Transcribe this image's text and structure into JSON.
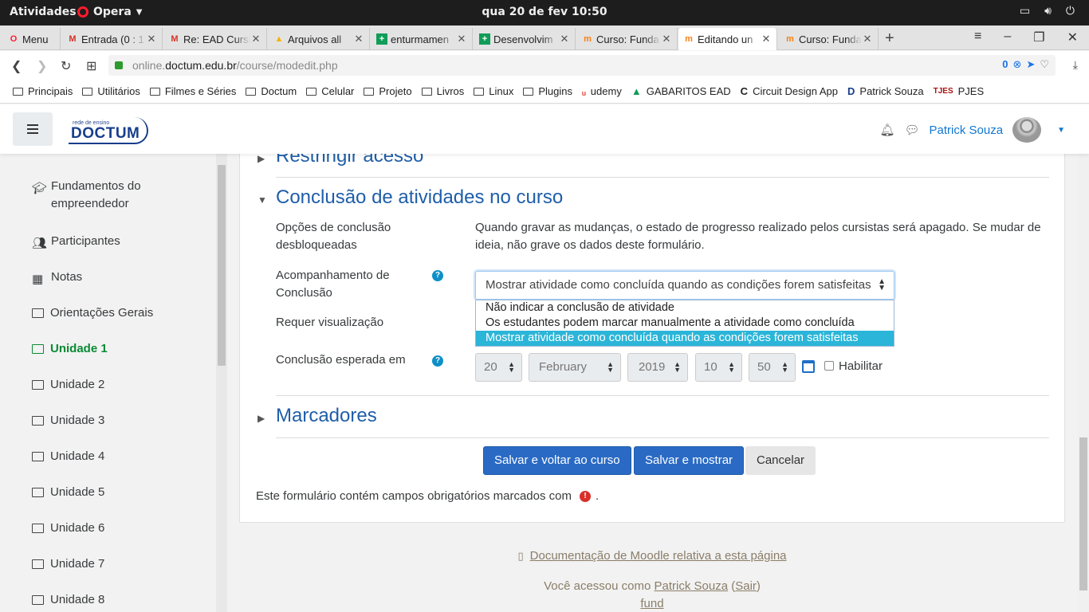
{
  "system": {
    "activities": "Atividades",
    "app_name": "Opera",
    "clock": "qua 20 de fev  10:50"
  },
  "tabs": [
    {
      "label": "Menu",
      "icon": "opera-icon"
    },
    {
      "label": "Entrada (0 : 1",
      "icon": "gmail-icon"
    },
    {
      "label": "Re: EAD Cursi",
      "icon": "gmail-icon"
    },
    {
      "label": "Arquivos all",
      "icon": "drive-icon"
    },
    {
      "label": "enturmamen",
      "icon": "sheets-icon"
    },
    {
      "label": "Desenvolvim",
      "icon": "sheets-icon"
    },
    {
      "label": "Curso: Funda",
      "icon": "moodle-icon"
    },
    {
      "label": "Editando un",
      "icon": "moodle-icon"
    },
    {
      "label": "Curso: Funda",
      "icon": "moodle-icon"
    }
  ],
  "address": {
    "host_prefix": "online.",
    "host": "doctum.edu.br",
    "path": "/course/modedit.php",
    "badge": "0"
  },
  "bookmarks": [
    {
      "label": "Principais",
      "type": "folder"
    },
    {
      "label": "Utilitários",
      "type": "folder"
    },
    {
      "label": "Filmes e Séries",
      "type": "folder"
    },
    {
      "label": "Doctum",
      "type": "folder"
    },
    {
      "label": "Celular",
      "type": "folder"
    },
    {
      "label": "Projeto",
      "type": "folder"
    },
    {
      "label": "Livros",
      "type": "folder"
    },
    {
      "label": "Linux",
      "type": "folder"
    },
    {
      "label": "Plugins",
      "type": "folder"
    },
    {
      "label": "udemy",
      "type": "udemy-icon"
    },
    {
      "label": "GABARITOS EAD",
      "type": "drive-icon"
    },
    {
      "label": "Circuit Design App",
      "type": "circuit-icon"
    },
    {
      "label": "Patrick Souza",
      "type": "d-icon"
    },
    {
      "label": "PJES",
      "type": "pjes-icon"
    }
  ],
  "header": {
    "logo_small": "rede de ensino",
    "logo_big": "DOCTUM",
    "user_name": "Patrick Souza"
  },
  "sidebar": {
    "items": [
      {
        "label": "Fundamentos do empreendedor",
        "icon": "graduation-cap-icon",
        "active": false
      },
      {
        "label": "Participantes",
        "icon": "users-icon",
        "active": false
      },
      {
        "label": "Notas",
        "icon": "table-icon",
        "active": false
      },
      {
        "label": "Orientações Gerais",
        "icon": "folder-icon",
        "active": false
      },
      {
        "label": "Unidade 1",
        "icon": "folder-icon",
        "active": true
      },
      {
        "label": "Unidade 2",
        "icon": "folder-icon",
        "active": false
      },
      {
        "label": "Unidade 3",
        "icon": "folder-icon",
        "active": false
      },
      {
        "label": "Unidade 4",
        "icon": "folder-icon",
        "active": false
      },
      {
        "label": "Unidade 5",
        "icon": "folder-icon",
        "active": false
      },
      {
        "label": "Unidade 6",
        "icon": "folder-icon",
        "active": false
      },
      {
        "label": "Unidade 7",
        "icon": "folder-icon",
        "active": false
      },
      {
        "label": "Unidade 8",
        "icon": "folder-icon",
        "active": false
      }
    ]
  },
  "form": {
    "restrict_title": "Restringir acesso",
    "completion_title": "Conclusão de atividades no curso",
    "unlocked_label": "Opções de conclusão desbloqueadas",
    "unlocked_text": "Quando gravar as mudanças, o estado de progresso realizado pelos cursistas será apagado. Se mudar de ideia, não grave os dados deste formulário.",
    "tracking_label": "Acompanhamento de Conclusão",
    "tracking_value": "Mostrar atividade como concluída quando as condições forem satisfeitas",
    "tracking_options": [
      "Não indicar a conclusão de atividade",
      "Os estudantes podem marcar manualmente a atividade como concluída",
      "Mostrar atividade como concluída quando as condições forem satisfeitas"
    ],
    "view_label": "Requer visualização",
    "expected_label": "Conclusão esperada em",
    "date": {
      "day": "20",
      "month": "February",
      "year": "2019",
      "hour": "10",
      "minute": "50"
    },
    "enable_label": "Habilitar",
    "tags_title": "Marcadores",
    "save_return": "Salvar e voltar ao curso",
    "save_show": "Salvar e mostrar",
    "cancel": "Cancelar",
    "required_note": "Este formulário contém campos obrigatórios marcados com",
    "required_end": "."
  },
  "footer": {
    "doc_link": "Documentação de Moodle relativa a esta página",
    "logged_prefix": "Você acessou como",
    "user_link": "Patrick Souza",
    "logout": "Sair",
    "fund": "fund"
  },
  "colors": {
    "accent": "#1f5ea8",
    "active": "#0a8a34",
    "primary_btn": "#2a6ac4",
    "highlight": "#2bb5d8"
  }
}
